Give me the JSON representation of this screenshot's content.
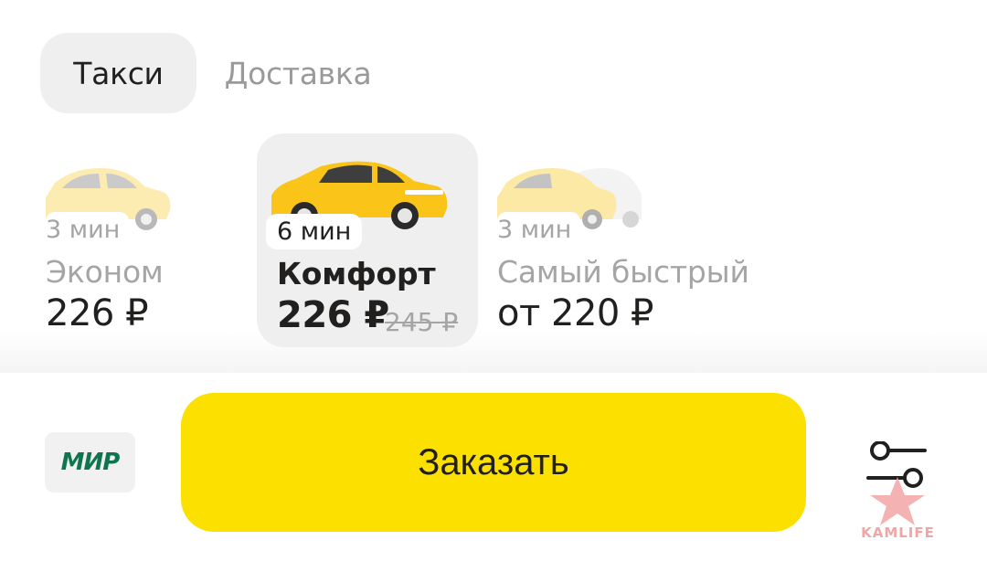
{
  "tabs": [
    {
      "label": "Такси",
      "active": true
    },
    {
      "label": "Доставка",
      "active": false
    }
  ],
  "tariffs": [
    {
      "eta": "3 мин",
      "name": "Эконом",
      "price": "226 ₽",
      "old_price": "",
      "selected": false,
      "car_icon": "yellow-sedan-icon"
    },
    {
      "eta": "6 мин",
      "name": "Комфорт",
      "price": "226 ₽",
      "old_price": "245 ₽",
      "selected": true,
      "car_icon": "yellow-sedan-icon"
    },
    {
      "eta": "3 мин",
      "name": "Самый быстрый",
      "price": "от 220 ₽",
      "old_price": "",
      "selected": false,
      "car_icon": "yellow-and-white-cars-icon"
    }
  ],
  "payment": {
    "card_logo": "МИР",
    "icon": "mir-card-icon"
  },
  "order_button": {
    "label": "Заказать"
  },
  "settings": {
    "icon": "sliders-settings-icon"
  },
  "watermark": {
    "text": "KAMLIFE",
    "icon": "star-icon"
  },
  "colors": {
    "accent": "#fce000",
    "mir_green": "#0f754e",
    "selected_bg": "#efefef",
    "muted_text": "#a5a5a5"
  }
}
